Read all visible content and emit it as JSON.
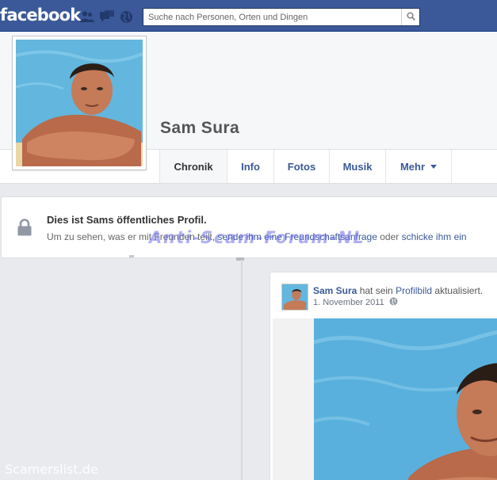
{
  "topbar": {
    "logo": "facebook",
    "search_placeholder": "Suche nach Personen, Orten und Dingen"
  },
  "profile": {
    "name": "Sam Sura"
  },
  "nav": {
    "tabs": [
      {
        "label": "Chronik",
        "active": true
      },
      {
        "label": "Info"
      },
      {
        "label": "Fotos"
      },
      {
        "label": "Musik"
      },
      {
        "label": "Mehr"
      }
    ]
  },
  "notice": {
    "title": "Dies ist Sams öffentliches Profil.",
    "text_before": "Um zu sehen, was er mit Freunden teilt, ",
    "link_friend_request": "sende ihm eine Freundschaftsanfrage",
    "text_or": " oder ",
    "link_message": "schicke ihm ein"
  },
  "post": {
    "author": "Sam Sura",
    "action_before": " hat sein ",
    "action_link": "Profilbild",
    "action_after": " aktualisiert.",
    "date": "1. November 2011"
  },
  "watermarks": {
    "center": "Anti-Scam-Forum-NL",
    "bottom": "Scamerslist.de"
  },
  "colors": {
    "brand": "#3b5998",
    "background": "#e9eaed",
    "link": "#3b5998",
    "pool": "#5ab0dc",
    "skin": "#c97d5d"
  },
  "icons": [
    "friends-icon",
    "messages-icon",
    "globe-icon",
    "search-icon",
    "lock-icon",
    "globe-privacy-icon",
    "caret-down-icon"
  ]
}
